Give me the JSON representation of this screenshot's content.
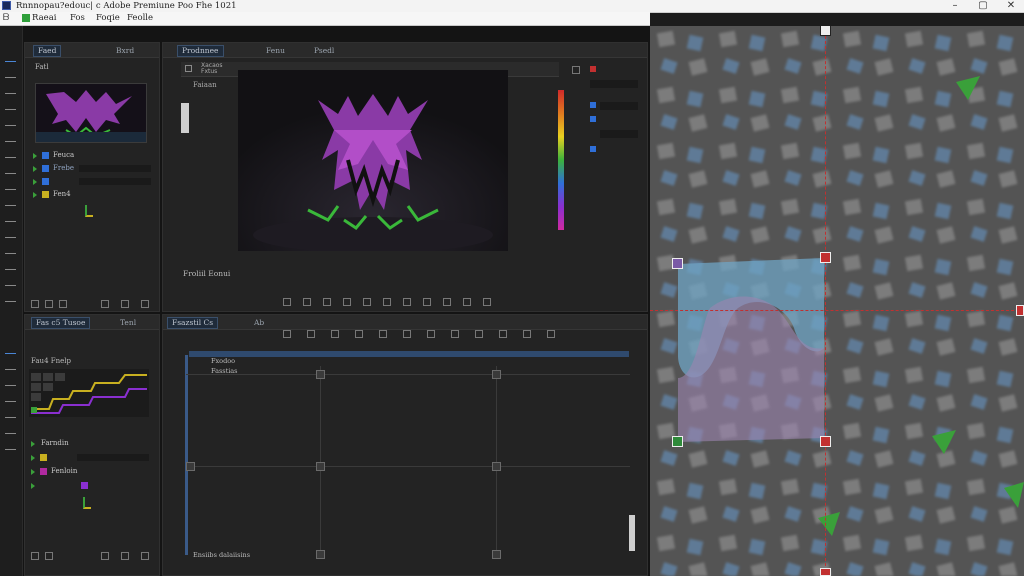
{
  "window": {
    "title": "Rnnnopau?edouc| c Adobe Premiune Poo Fhe 1021",
    "minimize": "–",
    "maximize": "▢",
    "close": "✕"
  },
  "menu": {
    "items": [
      "ᗷ",
      "Raeai",
      "Fos",
      "Foqie",
      "Feolle"
    ]
  },
  "panels": {
    "effects": {
      "tab": "Faed",
      "tab2": "Bxrd",
      "subtitle": "Fatl",
      "rows": [
        {
          "label": "Feuca",
          "color": "#2f6fd8"
        },
        {
          "label": "Frebe",
          "color": "#2f6fd8"
        },
        {
          "label": "Fen4",
          "color": "#c8b020"
        }
      ]
    },
    "program": {
      "tab": "Prodnnee",
      "tab2": "Fenu",
      "tab3": "Psedl",
      "header_label": "Faiaan",
      "bottom_label": "Froliil Eonui",
      "list_labels": [
        "Xacaos",
        "Fxtus"
      ]
    },
    "project": {
      "tab": "Fas c5 Tusoe",
      "tab2": "Tenl",
      "subtitle": "Fau4 Fnelp",
      "rows": [
        {
          "label": "Farndin",
          "color": "#c8b020"
        },
        {
          "label": "Fenloin",
          "color": "#b02aa0"
        },
        {
          "label": "",
          "color": "#8a2fd0"
        }
      ]
    },
    "timeline": {
      "tab": "Fsazstil Cs",
      "tab2": "Ab",
      "tracks": [
        "Fxodoo",
        "Fasstias"
      ],
      "bottom_label": "Ensiibs dalaiisins"
    }
  },
  "colors": {
    "accent": "#4a86d6",
    "guide": "#c23030",
    "selection_blue": "#6fa4c4",
    "selection_purple": "#9c86b0"
  }
}
